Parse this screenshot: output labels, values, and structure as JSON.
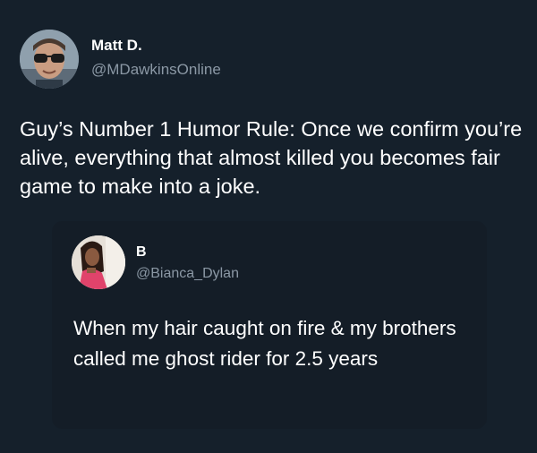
{
  "tweet": {
    "user": {
      "name": "Matt D.",
      "handle": "@MDawkinsOnline"
    },
    "text": "Guy’s Number 1 Humor Rule: Once we confirm you’re alive, everything that almost killed you becomes fair game to make into a joke."
  },
  "quoted_tweet": {
    "user": {
      "name": "B",
      "handle": "@Bianca_Dylan"
    },
    "text": "When my hair caught on fire & my brothers called me ghost rider for 2.5 years"
  },
  "colors": {
    "background": "#15202b",
    "quote_background": "#141d27",
    "primary_text": "#ffffff",
    "secondary_text": "#8b98a5"
  }
}
